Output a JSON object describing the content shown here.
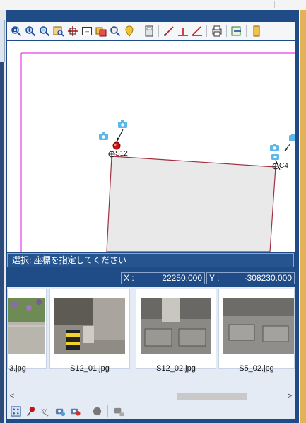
{
  "status": {
    "message": "選択: 座標を指定してください"
  },
  "coordinates": {
    "x_label": "X :",
    "x_value": "22250.000",
    "y_label": "Y :",
    "y_value": "-308230.000"
  },
  "map": {
    "points": [
      {
        "name": "S12",
        "label": "S12"
      },
      {
        "name": "C4",
        "label": "C4"
      }
    ]
  },
  "thumbnails": [
    {
      "filename": "3.jpg"
    },
    {
      "filename": "S12_01.jpg"
    },
    {
      "filename": "S12_02.jpg"
    },
    {
      "filename": "S5_02.jpg"
    }
  ],
  "scrollbar": {
    "left_arrow": "<",
    "right_arrow": ">"
  },
  "toolbar_icons": [
    "zoom-fit-icon",
    "zoom-in-icon",
    "zoom-out-icon",
    "zoom-window-icon",
    "pan-icon",
    "full-view-icon",
    "layer-icon",
    "find-icon",
    "marker-icon",
    "calculator-icon",
    "draw-line-icon",
    "perpendicular-icon",
    "angle-icon",
    "print-icon",
    "export-icon",
    "settings-icon"
  ],
  "bottom_icons": [
    "grid-icon",
    "pin-icon",
    "xy-icon",
    "camera-link-icon",
    "camera-remove-icon",
    "record-icon",
    "camera-disabled-icon"
  ],
  "colors": {
    "panel": "#1f4b86",
    "boundary": "#e83be8",
    "parcel_line": "#a2313f",
    "parcel_fill": "#e9e9e9",
    "camera": "#5bb8e8",
    "accent_right": "#e3b258"
  }
}
